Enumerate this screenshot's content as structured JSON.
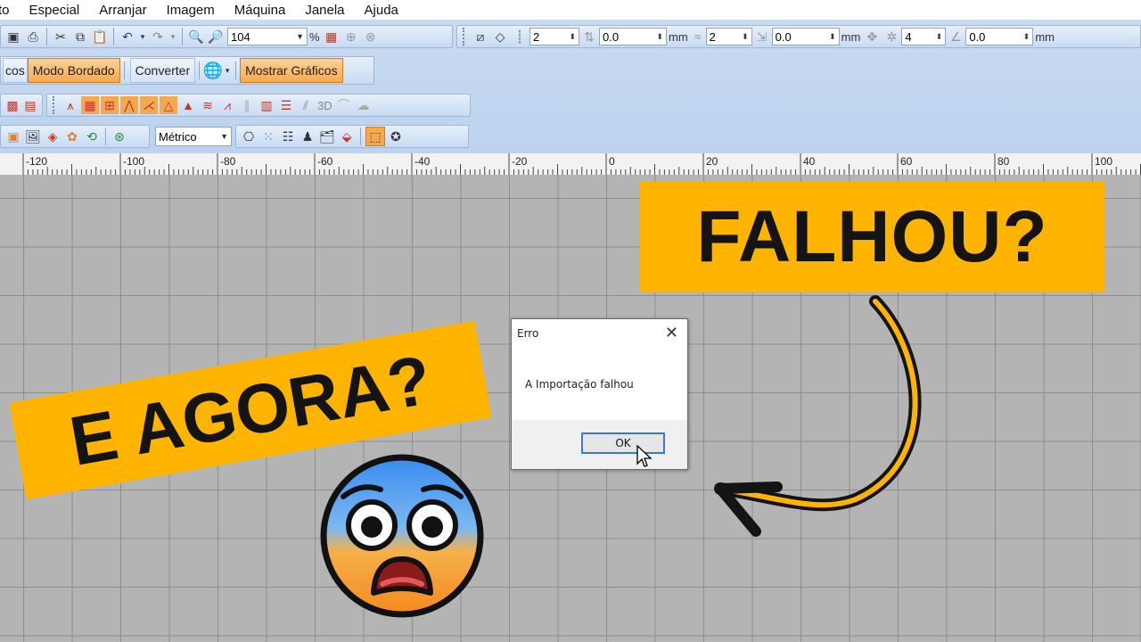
{
  "menu": [
    "to",
    "Especial",
    "Arranjar",
    "Imagem",
    "Máquina",
    "Janela",
    "Ajuda"
  ],
  "toolbar": {
    "zoom_value": "104",
    "zoom_unit": "%",
    "spin1": "2",
    "spin2": "0.0",
    "unit_mm": "mm",
    "spin3": "2",
    "spin4": "0.0",
    "spin5": "4",
    "spin6": "0.0",
    "btn_cos": "cos",
    "btn_modo_bordado": "Modo Bordado",
    "btn_converter": "Converter",
    "btn_mostrar_graficos": "Mostrar Gráficos",
    "label_3d": "3D",
    "units_select": "Métrico"
  },
  "ruler": {
    "labels": [
      "-120",
      "-100",
      "-80",
      "-60",
      "-40",
      "-20",
      "0",
      "20",
      "40",
      "60",
      "80",
      "100"
    ]
  },
  "dialog": {
    "title": "Erro",
    "message": "A Importação falhou",
    "ok_label": "OK"
  },
  "overlay": {
    "falhou": "FALHOU?",
    "agora": "E AGORA?"
  },
  "colors": {
    "banner": "#ffb400",
    "active_button": "#f5a94e",
    "toolbar_bg": "#c9dbf2",
    "canvas_bg": "#b4b4b4"
  }
}
